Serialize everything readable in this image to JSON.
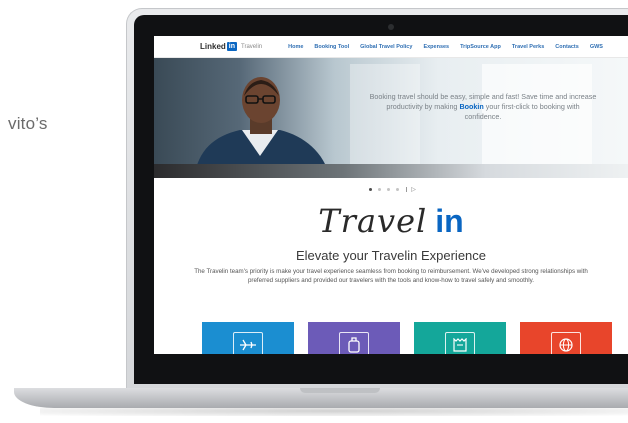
{
  "side_text": "vito’s",
  "nav": {
    "logo_text": "Linked",
    "logo_in": "in",
    "logo_sub": "Travelin",
    "items": [
      "Home",
      "Booking Tool",
      "Global Travel Policy",
      "Expenses",
      "TripSource App",
      "Travel Perks",
      "Contacts",
      "GWS"
    ]
  },
  "hero": {
    "text_before": "Booking travel should be easy, simple and fast! Save time and increase productivity by making ",
    "text_highlight": "Bookin",
    "text_after": " your first-click to booking with confidence."
  },
  "carousel": {
    "dots": 4,
    "active_index": 0,
    "play_icon": "play-icon"
  },
  "brand": {
    "script": "Travel",
    "in": "in"
  },
  "headline": "Elevate your Travelin Experience",
  "paragraph": "The Travelin team's priority is make your travel experience seamless from booking to reimbursement. We've developed strong relationships with preferred suppliers and provided our travelers with the tools and know-how to travel safely and smoothly.",
  "tiles": [
    {
      "icon": "airplane-ticket-icon",
      "color": "#1b8ed1"
    },
    {
      "icon": "luggage-icon",
      "color": "#6c5bb8"
    },
    {
      "icon": "receipt-icon",
      "color": "#14a79a"
    },
    {
      "icon": "globe-passport-icon",
      "color": "#e8452b"
    }
  ],
  "colors": {
    "accent": "#0a66c2",
    "menu": "#2f6fb3"
  }
}
